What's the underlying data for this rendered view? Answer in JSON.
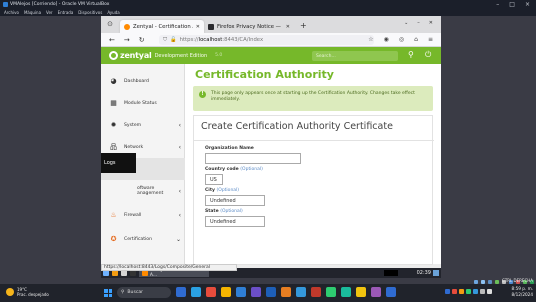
{
  "vbox": {
    "title": "VMAlejos [Corriendo] - Oracle VM VirtualBox",
    "menu": [
      "Archivo",
      "Máquina",
      "Ver",
      "Entrada",
      "Dispositivos",
      "Ayuda"
    ],
    "window_controls": [
      "–",
      "□",
      "×"
    ]
  },
  "browser": {
    "tabs": [
      {
        "label": "Zentyal - Certification A",
        "active": true
      },
      {
        "label": "Firefox Privacy Notice —",
        "active": false
      }
    ],
    "new_tab": "+",
    "url_prefix": "https://",
    "url_host": "localhost",
    "url_rest": ":8443/CA/Index",
    "status_url": "https://localhost:8443/Logs/Composite/General"
  },
  "zentyal": {
    "brand": "zentyal",
    "edition": "Development Edition",
    "version": "5.0",
    "search_placeholder": "Search..."
  },
  "sidebar": {
    "items": [
      {
        "label": "Dashboard",
        "icon": "dashboard-icon"
      },
      {
        "label": "Module Status",
        "icon": "module-status-icon"
      },
      {
        "label": "System",
        "icon": "gear-icon"
      },
      {
        "label": "Network",
        "icon": "network-icon"
      },
      {
        "label": "Logs",
        "icon": "logs-icon"
      },
      {
        "label": "Software Management",
        "icon": "package-icon"
      },
      {
        "label": "Firewall",
        "icon": "firewall-icon"
      },
      {
        "label": "Certification",
        "icon": "certificate-icon"
      }
    ],
    "tooltip": "Logs",
    "software_line1": "oftware",
    "software_line2": "anagement"
  },
  "main": {
    "title": "Certification Authority",
    "notice": "This page only appears once at starting up the Certification Authority. Changes take effect immediately.",
    "section_title": "Create Certification Authority Certificate",
    "fields": [
      {
        "label": "Organization Name",
        "optional": "",
        "value": ""
      },
      {
        "label": "Country code",
        "optional": "(Optional)",
        "value": "US"
      },
      {
        "label": "City",
        "optional": "(Optional)",
        "value": "Undefined"
      },
      {
        "label": "State",
        "optional": "(Optional)",
        "value": "Undefined"
      }
    ]
  },
  "guest_taskbar": {
    "app_label": "Zentyal - Certification A...",
    "clock": "02:39"
  },
  "host_taskbar": {
    "weather_temp": "19°C",
    "weather_desc": "Prac. despejado",
    "search_label": "Buscar",
    "time": "8:59 p. m.",
    "date": "8/12/2024",
    "ctl": "CTRL DERECHA"
  }
}
